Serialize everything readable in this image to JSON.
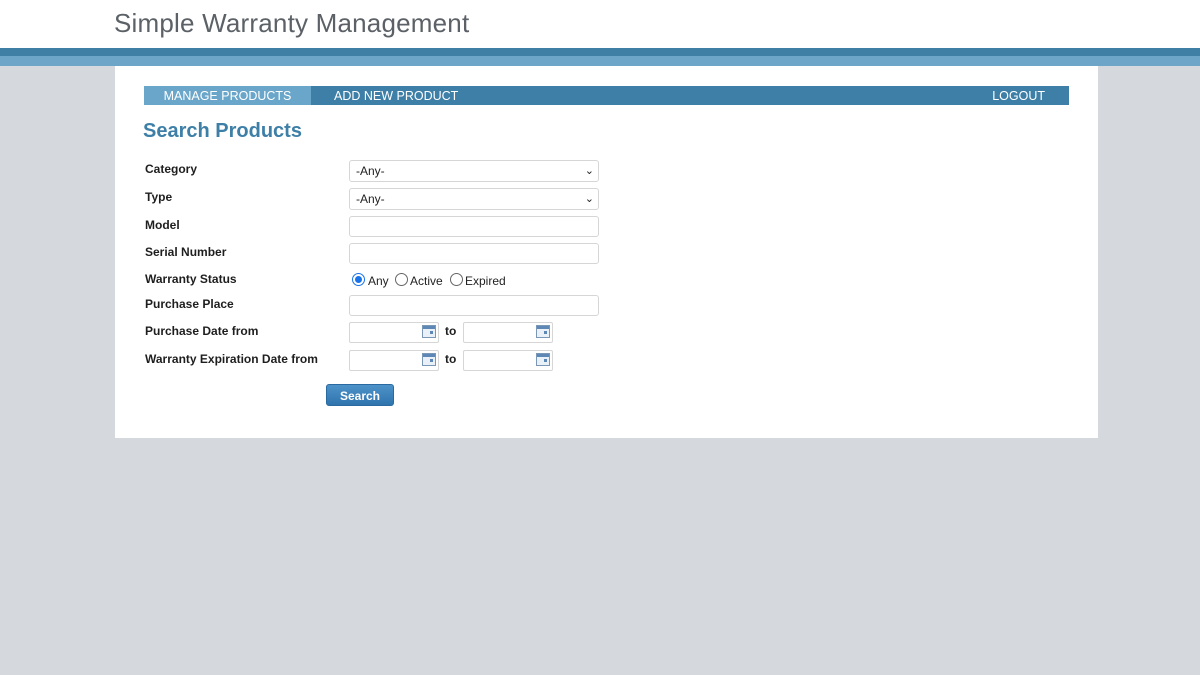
{
  "app": {
    "title": "Simple Warranty Management"
  },
  "nav": {
    "items": [
      {
        "label": "MANAGE PRODUCTS",
        "active": true
      },
      {
        "label": "ADD NEW PRODUCT",
        "active": false
      }
    ],
    "logout_label": "LOGOUT"
  },
  "page": {
    "title": "Search Products"
  },
  "form": {
    "category": {
      "label": "Category",
      "value": "-Any-"
    },
    "type": {
      "label": "Type",
      "value": "-Any-"
    },
    "model": {
      "label": "Model",
      "value": ""
    },
    "serial_number": {
      "label": "Serial Number",
      "value": ""
    },
    "warranty_status": {
      "label": "Warranty Status",
      "options": [
        "Any",
        "Active",
        "Expired"
      ],
      "selected": "Any"
    },
    "purchase_place": {
      "label": "Purchase Place",
      "value": ""
    },
    "purchase_date": {
      "label": "Purchase Date from",
      "to_label": "to",
      "from": "",
      "to": ""
    },
    "warranty_expiration_date": {
      "label": "Warranty Expiration Date from",
      "to_label": "to",
      "from": "",
      "to": ""
    },
    "search_label": "Search"
  },
  "colors": {
    "accent": "#3e7fa7",
    "accent_light": "#6aa6c9",
    "background": "#d5d9dd",
    "button": "#3a80b9"
  },
  "icons": {
    "calendar": "calendar-icon",
    "dropdown": "chevron-down-icon"
  }
}
